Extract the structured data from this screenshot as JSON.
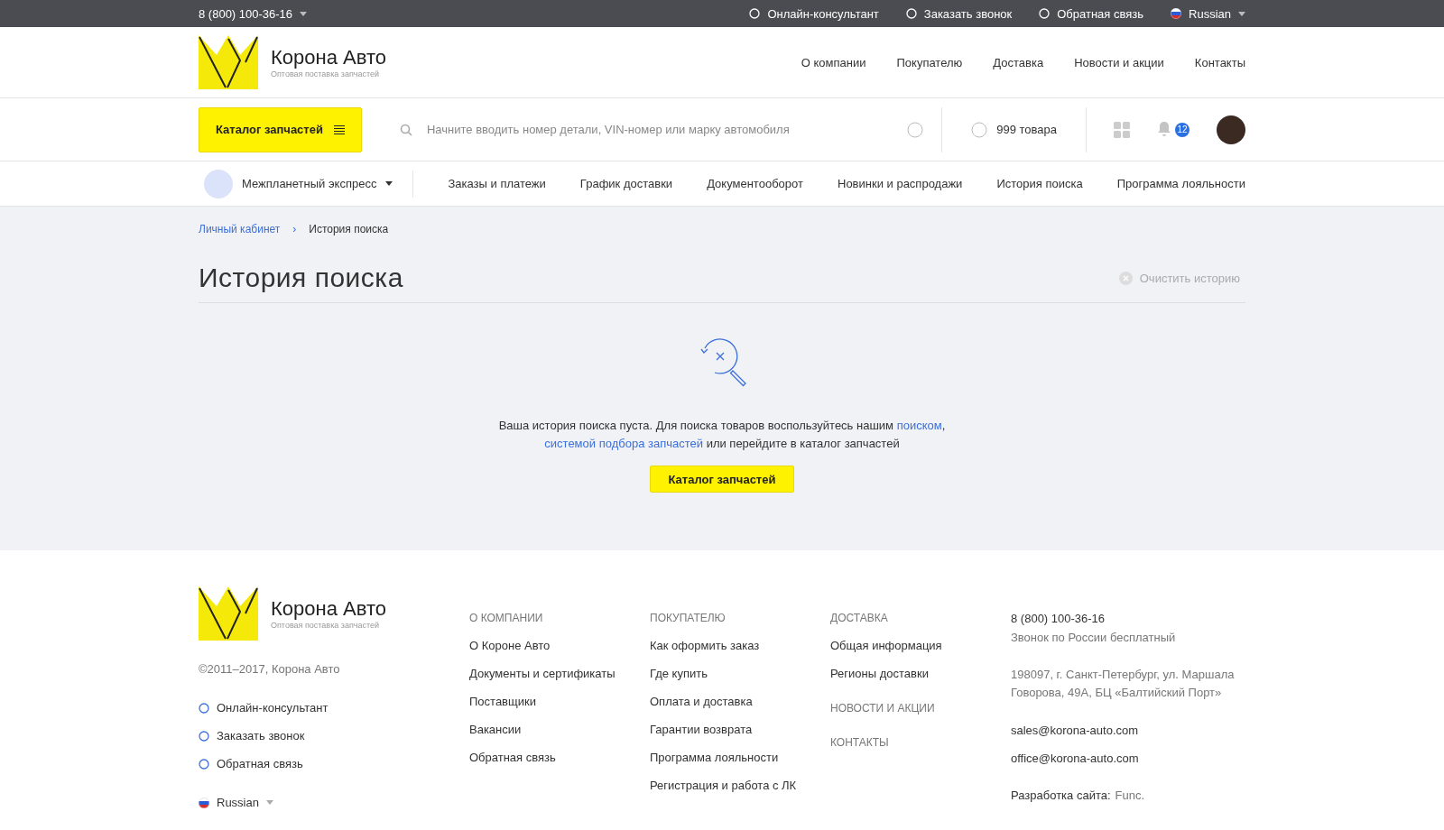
{
  "top_bar": {
    "phone": "8 (800) 100-36-16",
    "links": [
      "Онлайн-консультант",
      "Заказать звонок",
      "Обратная связь"
    ],
    "language": "Russian"
  },
  "header": {
    "logo": {
      "name": "Корона Авто",
      "tagline": "Оптовая поставка запчастей"
    },
    "nav": [
      "О компании",
      "Покупателю",
      "Доставка",
      "Новости и акции",
      "Контакты"
    ]
  },
  "toolbar": {
    "catalog_button": "Каталог запчастей",
    "search": {
      "placeholder": "Начните вводить номер детали, VIN-номер или марку автомобиля"
    },
    "cart": "999 товара",
    "notifications": "12"
  },
  "account_nav": {
    "company": "Межпланетный экспресс",
    "items": [
      "Заказы и платежи",
      "График доставки",
      "Документооборот",
      "Новинки и распродажи",
      "История поиска",
      "Программа лояльности"
    ]
  },
  "breadcrumb_separator": "›",
  "breadcrumbs": [
    {
      "label": "Личный кабинет",
      "kind": "link"
    },
    {
      "label": "История поиска",
      "kind": "current"
    }
  ],
  "page": {
    "title": "История поиска",
    "clear_action": "Очистить историю",
    "empty_message": [
      {
        "text": "Ваша история поиска пуста. Для поиска товаров воспользуйтесь нашим ",
        "kind": "text"
      },
      {
        "text": "поиском",
        "kind": "link"
      },
      {
        "text": ",",
        "kind": "text"
      },
      {
        "kind": "break"
      },
      {
        "text": "системой подбора запчастей",
        "kind": "link"
      },
      {
        "text": " или перейдите в каталог запчастей",
        "kind": "text"
      }
    ],
    "catalog_button": "Каталог запчастей"
  },
  "footer": {
    "logo": {
      "name": "Корона Авто",
      "tagline": "Оптовая поставка запчастей"
    },
    "copyright": "©2011–2017, Корона Авто",
    "links": [
      "Онлайн-консультант",
      "Заказать звонок",
      "Обратная связь"
    ],
    "language": "Russian",
    "columns": [
      [
        {
          "heading": "О КОМПАНИИ",
          "links": [
            "О Короне Авто",
            "Документы и сертификаты",
            "Поставщики",
            "Вакансии",
            "Обратная связь"
          ]
        }
      ],
      [
        {
          "heading": "ПОКУПАТЕЛЮ",
          "links": [
            "Как оформить заказ",
            "Где купить",
            "Оплата и доставка",
            "Гарантии возврата",
            "Программа лояльности",
            "Регистрация и работа с ЛК"
          ]
        }
      ],
      [
        {
          "heading": "ДОСТАВКА",
          "links": [
            "Общая информация",
            "Регионы доставки"
          ]
        },
        {
          "heading": "НОВОСТИ И АКЦИИ"
        },
        {
          "heading": "КОНТАКТЫ"
        }
      ]
    ],
    "contacts": {
      "phone": "8 (800) 100-36-16",
      "phone_note": "Звонок по России бесплатный",
      "address": "198097, г. Санкт-Петербург, ул. Маршала Говорова, 49А, БЦ «Балтийский Порт»",
      "emails": [
        "sales@korona-auto.com",
        "office@korona-auto.com"
      ],
      "credit_label": "Разработка сайта:",
      "credit_link": "Func."
    }
  }
}
